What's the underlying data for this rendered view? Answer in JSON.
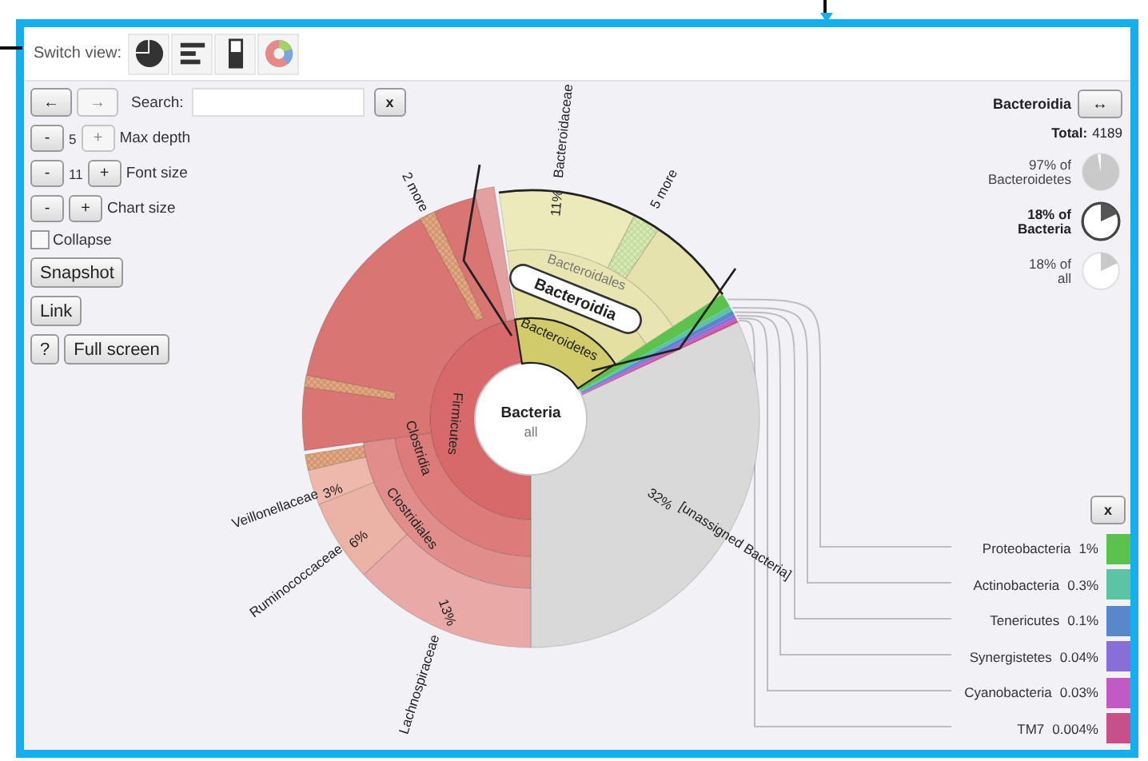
{
  "toolbar": {
    "label": "Switch view:",
    "views": [
      {
        "kind": "pie"
      },
      {
        "kind": "bars"
      },
      {
        "kind": "column"
      },
      {
        "kind": "sunburst"
      }
    ]
  },
  "nav": [
    {
      "label": "←",
      "disabled": false
    },
    {
      "label": "→",
      "disabled": true
    }
  ],
  "search": {
    "label": "Search:",
    "clear": "x"
  },
  "steppers": [
    {
      "minus": {
        "label": "-",
        "disabled": false
      },
      "value": "5",
      "plus": {
        "label": "+",
        "disabled": true
      },
      "label": "Max depth"
    },
    {
      "minus": {
        "label": "-",
        "disabled": false
      },
      "value": "11",
      "plus": {
        "label": "+",
        "disabled": false
      },
      "label": "Font size"
    },
    {
      "minus": {
        "label": "-",
        "disabled": false
      },
      "plus": {
        "label": "+",
        "disabled": false
      },
      "label": "Chart size"
    }
  ],
  "collapse": {
    "label": "Collapse",
    "checked": false
  },
  "buttons": [
    [
      "Snapshot"
    ],
    [
      "Link"
    ],
    [
      "?",
      "Full screen"
    ]
  ],
  "details": {
    "name": "Bacteroidia",
    "swap": "↔",
    "total_label": "Total:",
    "total": "4189",
    "shares": [
      {
        "lines": [
          "97% of",
          "Bacteroidetes"
        ],
        "emphasized": false
      },
      {
        "lines": [
          "18% of",
          "Bacteria"
        ],
        "emphasized": true
      },
      {
        "lines": [
          "18% of",
          "all"
        ],
        "emphasized": false
      }
    ]
  },
  "center": {
    "name": "Bacteria",
    "sub": "all"
  },
  "chart_labels": [
    {
      "text": "2 more",
      "kind": "outer"
    },
    {
      "text": "Bacteroidaceae",
      "kind": "outer"
    },
    {
      "text": "11%",
      "kind": "inner"
    },
    {
      "text": "5 more",
      "kind": "outer"
    },
    {
      "text": "Bacteroidales",
      "kind": "muted"
    },
    {
      "text": "Bacteroidia",
      "kind": "pill"
    },
    {
      "text": "Bacteroidetes",
      "kind": "inner"
    },
    {
      "text": "Firmicutes",
      "kind": "inner"
    },
    {
      "text": "Clostridia",
      "kind": "inner"
    },
    {
      "text": "Clostridiales",
      "kind": "inner"
    },
    {
      "text": "Veillonellaceae",
      "kind": "outer"
    },
    {
      "text": "3%",
      "kind": "inner"
    },
    {
      "text": "Ruminococcaceae",
      "kind": "outer"
    },
    {
      "text": "6%",
      "kind": "inner"
    },
    {
      "text": "Lachnospiraceae",
      "kind": "outer"
    },
    {
      "text": "13%",
      "kind": "inner"
    },
    {
      "text": "32%",
      "kind": "inner"
    },
    {
      "text": "[unassigned Bacteria]",
      "kind": "inner"
    }
  ],
  "legend": {
    "close": "x",
    "items": [
      {
        "name": "Proteobacteria",
        "percent": "1%",
        "color": "#5cc24e"
      },
      {
        "name": "Actinobacteria",
        "percent": "0.3%",
        "color": "#5cc4a4"
      },
      {
        "name": "Tenericutes",
        "percent": "0.1%",
        "color": "#5a86cc"
      },
      {
        "name": "Synergistetes",
        "percent": "0.04%",
        "color": "#8a6ed8"
      },
      {
        "name": "Cyanobacteria",
        "percent": "0.03%",
        "color": "#c25ac6"
      },
      {
        "name": "TM7",
        "percent": "0.004%",
        "color": "#c8508a"
      }
    ]
  }
}
